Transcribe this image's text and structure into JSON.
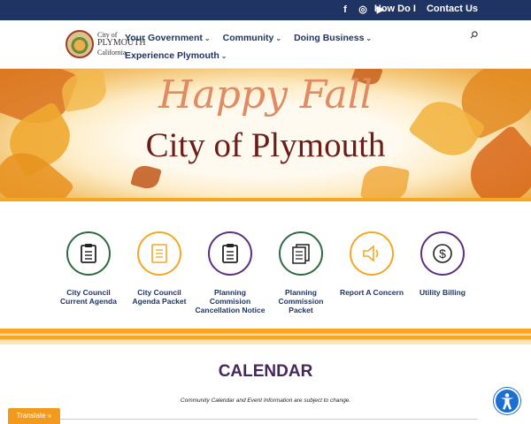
{
  "topbar": {
    "social": [
      {
        "icon": "facebook-icon",
        "glyph": "f"
      },
      {
        "icon": "instagram-icon",
        "glyph": "◎"
      },
      {
        "icon": "youtube-icon",
        "glyph": "▶"
      }
    ],
    "links": [
      "How Do I",
      "Contact Us"
    ]
  },
  "logo": {
    "line1": "City of",
    "line2": "PLYMOUTH",
    "line3": "California"
  },
  "nav": {
    "row1": [
      "Your Government",
      "Community",
      "Doing Business"
    ],
    "row2": [
      "Experience Plymouth"
    ],
    "chevron": "⌄",
    "search_icon": "search-icon"
  },
  "hero": {
    "script": "Happy Fall",
    "title": "City of Plymouth"
  },
  "quick_links": [
    {
      "label": "City Council Current Agenda",
      "icon": "clipboard-icon",
      "color": "#2e6b3f"
    },
    {
      "label": "City Council Agenda Packet",
      "icon": "document-icon",
      "color": "#f5a623"
    },
    {
      "label": "Planning Commision Cancellation Notice",
      "icon": "clipboard-icon",
      "color": "#5b2f82"
    },
    {
      "label": "Planning Commission Packet",
      "icon": "documents-icon",
      "color": "#2e6b3f"
    },
    {
      "label": "Report A Concern",
      "icon": "speaker-icon",
      "color": "#f5a623"
    },
    {
      "label": "Utility Billing",
      "icon": "dollar-icon",
      "color": "#5b2f82"
    }
  ],
  "calendar": {
    "title": "CALENDAR",
    "note": "Community Calendar and Event Information are subject to change."
  },
  "translate": {
    "label": "Translate »"
  },
  "colors": {
    "navy": "#1f3463",
    "orange": "#f5a623",
    "purple": "#5b2f82",
    "green": "#2e6b3f"
  }
}
